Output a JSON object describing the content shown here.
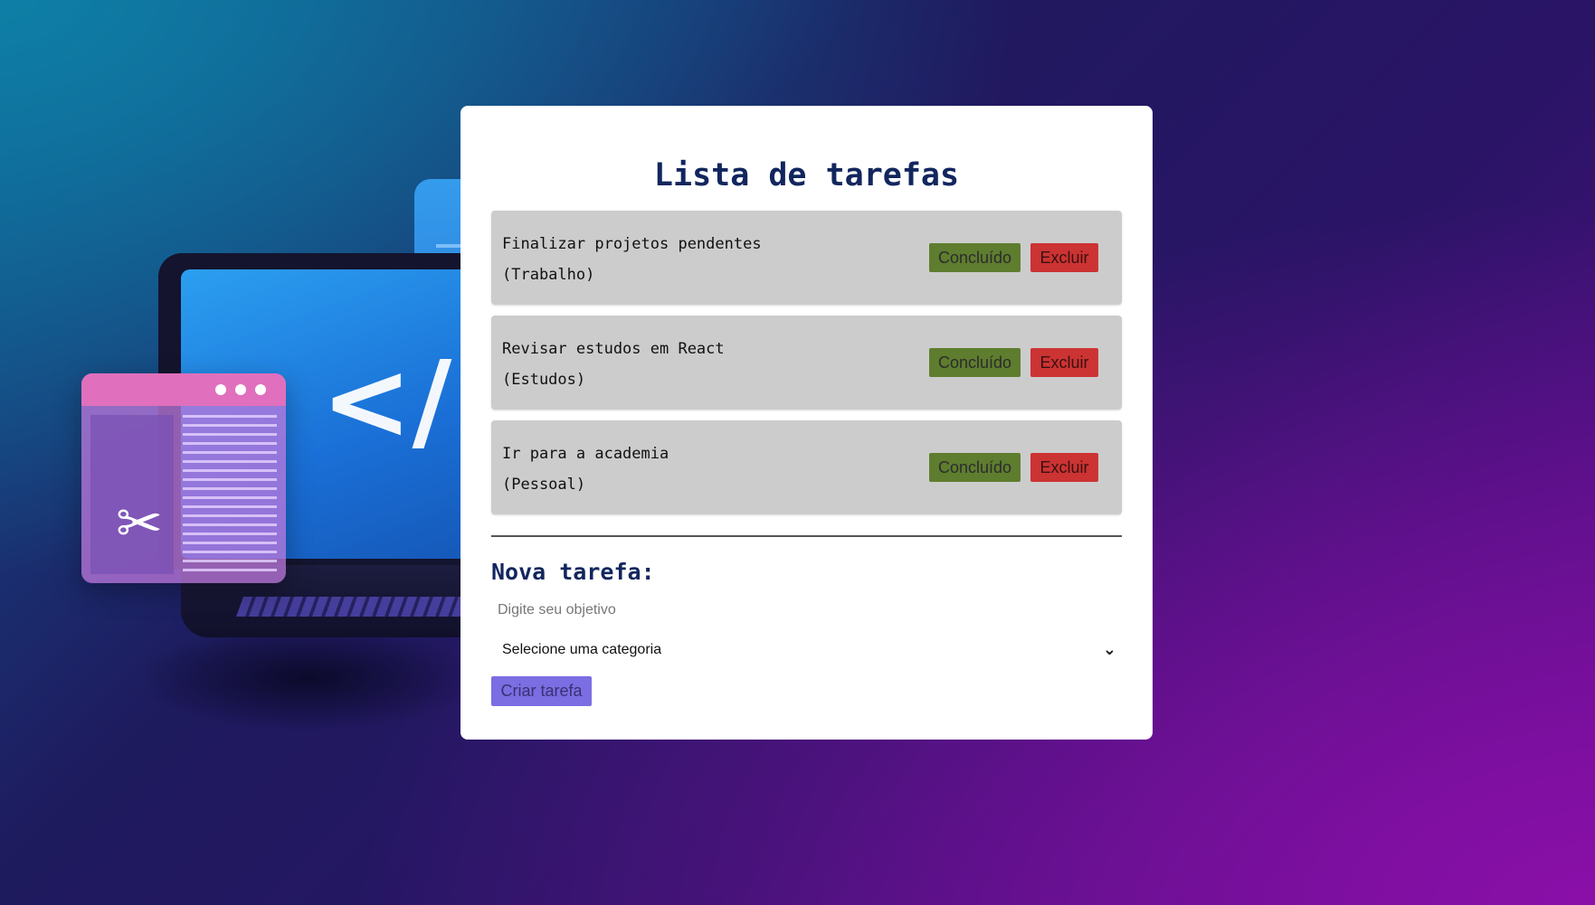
{
  "page": {
    "title": "Lista de tarefas"
  },
  "tasks": [
    {
      "name": "Finalizar projetos pendentes",
      "category": "(Trabalho)",
      "done_label": "Concluído",
      "delete_label": "Excluir"
    },
    {
      "name": "Revisar estudos em React",
      "category": "(Estudos)",
      "done_label": "Concluído",
      "delete_label": "Excluir"
    },
    {
      "name": "Ir para a academia",
      "category": "(Pessoal)",
      "done_label": "Concluído",
      "delete_label": "Excluir"
    }
  ],
  "form": {
    "title": "Nova tarefa:",
    "objective_placeholder": "Digite seu objetivo",
    "objective_value": "",
    "category_selected": "Selecione uma categoria",
    "submit_label": "Criar tarefa"
  },
  "illustration": {
    "code_symbol": "</>",
    "tools_symbol": "✂"
  },
  "colors": {
    "title": "#12265e",
    "done_button": "#5e7d2e",
    "delete_button": "#cc3333",
    "create_button": "#7b6ee3",
    "task_background": "#cccccc"
  }
}
